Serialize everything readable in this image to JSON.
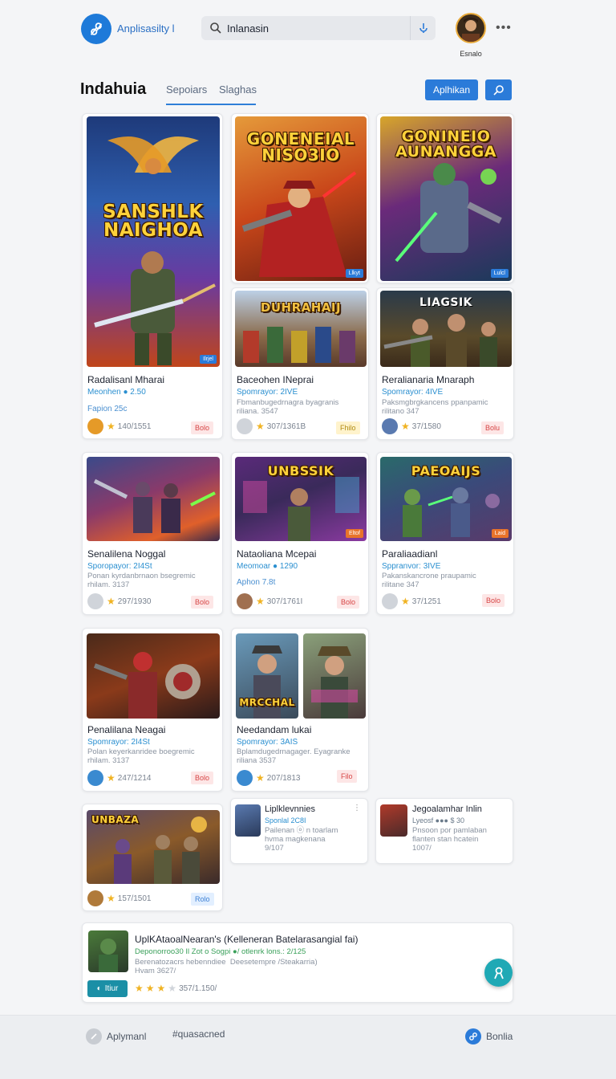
{
  "header": {
    "app_name": "Anplisasilty l",
    "search_value": "Inlanasin",
    "user_name": "Esnalo"
  },
  "toolbar": {
    "title": "Indahuia",
    "tabs": [
      "Sepoiars",
      "Slaghas"
    ],
    "primary_button": "Aplhikan"
  },
  "games": [
    {
      "art_title": "SANSHLK NAIGHOA",
      "tag": "Ilrjel",
      "title": "Radalisanl Mharai",
      "sub": "Meonhen ● 2.50",
      "desc": "Fapion 25c",
      "rating": "140/1551",
      "pill": "Bolo"
    },
    {
      "art_title": "GONENEIAL NISO3IO",
      "tag": "Llkyt",
      "title": "Baceohen INeprai",
      "sub": "Spomrayor: 2IVE",
      "desc": "Fbmanbugedrnagra byagranis\nriliana. 3547",
      "rating": "307/1361B",
      "pill": "Fhilo"
    },
    {
      "art_title": "GONINEIO AUNANGGA",
      "tag": "Lulcl",
      "title": "Reralianaria Mnaraph",
      "sub": "Spomrayor: 4IVE",
      "desc": "Paksmgbrgkancens ppanpamic\nrilitano 347",
      "rating": "37/1580",
      "pill": "Bolu"
    },
    {
      "art_title": "",
      "tag": "",
      "title": "Senalilena Noggal",
      "sub": "Sporopayor: 2I4St",
      "desc": "Ponan kyrdanbrnaon bsegremic\nrhilam. 3137",
      "rating": "297/1930",
      "pill": "Bolo"
    },
    {
      "art_title": "UNBSSIK",
      "tag": "Eltof",
      "title": "Nataoliana Mcepai",
      "sub": "Meomoar ● 1290",
      "desc": "Aphon 7.8t",
      "rating": "307/1761I",
      "pill": "Bolo"
    },
    {
      "art_title": "PAEOAIJS",
      "tag": "Laid",
      "title": "Paraliaadianl",
      "sub": "Sppranvor: 3IVE",
      "desc": "Pakanskancrone praupamic\nrilitane 347",
      "rating": "37/1251",
      "pill": "Bolo"
    },
    {
      "art_title": "",
      "tag": "",
      "title": "Penalilana Neagai",
      "sub": "Spomrayor: 2I4St",
      "desc": "Polan keyerkanridee boegremic\nrhilam. 3137",
      "rating": "247/1214",
      "pill": "Bolo"
    },
    {
      "art_title": "MRCCHAL",
      "tag": "",
      "title": "Needandam lukai",
      "sub": "Spomrayor: 3AIS",
      "desc": "Bplamdugedrnagager. Eyagranke\nriliana 3537",
      "rating": "207/1813",
      "pill": "Filo"
    },
    {
      "art_title": "UNBAZA",
      "tag": "",
      "title": "",
      "sub": "",
      "desc": "",
      "rating": "157/1501",
      "pill": "Rolo"
    }
  ],
  "mini_cards": [
    {
      "title": "Liplklevnnies",
      "sub": "Sponlal 2C8I",
      "desc": "Pailenan ⓞ n toarlam\nhvma magkenana\n9/107"
    },
    {
      "title": "Jegoalamhar Inlin",
      "sub": "Lyeosf ●●● $ 30",
      "desc": "Pnsoon por pamlaban\nflanten stan hcatein\n1007/"
    }
  ],
  "wide_card": {
    "title": "UplKAtaoalNearan's (Kelleneran Batelarasangial fai)",
    "sub": "Deponorroo30 Il Zot o Sogpi ●/ otlenrk lons.: 2/125",
    "desc": "Berenatozacrs hebenndiee  Deesetempre /Steakarria)\nHvam 3627/",
    "button": "Itiur",
    "rating": "357/1.150/"
  },
  "bottom_bar": {
    "left_label": "Aplymanl",
    "hashtag": "#quasacned",
    "right_label": "Bonlia"
  },
  "colors": {
    "accent": "#2b7bd9",
    "teal": "#1fa9b5",
    "star": "#f0b323"
  }
}
